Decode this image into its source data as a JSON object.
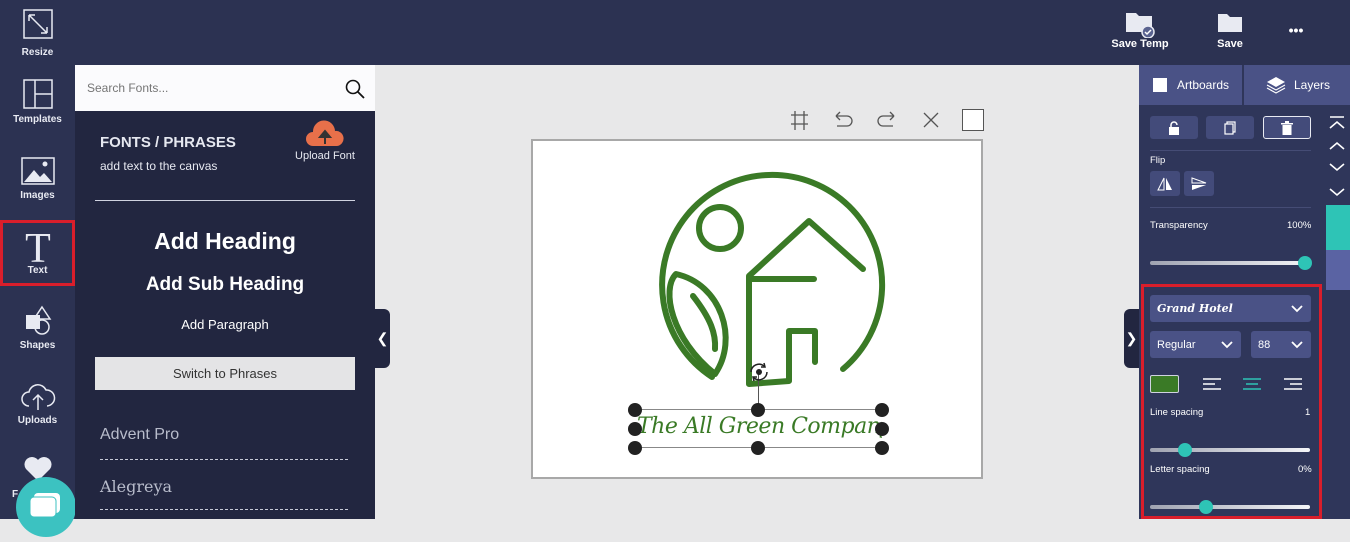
{
  "topbar": {
    "save_temp_label": "Save Temp",
    "save_label": "Save",
    "more_label": "•••"
  },
  "leftnav": {
    "items": [
      {
        "label": "Resize",
        "icon": "resize-icon"
      },
      {
        "label": "Templates",
        "icon": "templates-icon"
      },
      {
        "label": "Images",
        "icon": "images-icon"
      },
      {
        "label": "Text",
        "icon": "text-icon",
        "active": true
      },
      {
        "label": "Shapes",
        "icon": "shapes-icon"
      },
      {
        "label": "Uploads",
        "icon": "uploads-icon"
      },
      {
        "label": "F",
        "icon": "favorites-icon"
      }
    ]
  },
  "panel": {
    "search_placeholder": "Search Fonts...",
    "title": "FONTS / PHRASES",
    "subtitle": "add text to the canvas",
    "upload_label": "Upload Font",
    "add_heading": "Add Heading",
    "add_subheading": "Add Sub Heading",
    "add_paragraph": "Add Paragraph",
    "switch_label": "Switch to Phrases",
    "fonts": [
      "Advent Pro",
      "Alegreya"
    ]
  },
  "canvas": {
    "logo_text": "The All Green Company",
    "accent_color": "#3a7a26"
  },
  "rpanel": {
    "tabs": [
      {
        "label": "Artboards"
      },
      {
        "label": "Layers"
      }
    ],
    "flip_label": "Flip",
    "transparency_label": "Transparency",
    "transparency_value": "100%",
    "transparency_fraction": 0.97,
    "font_family": "Grand Hotel",
    "font_weight": "Regular",
    "font_size": "88",
    "text_color": "#3a7a26",
    "line_spacing_label": "Line spacing",
    "line_spacing_value": "1",
    "line_spacing_fraction": 0.22,
    "letter_spacing_label": "Letter spacing",
    "letter_spacing_value": "0%",
    "letter_spacing_fraction": 0.35
  }
}
